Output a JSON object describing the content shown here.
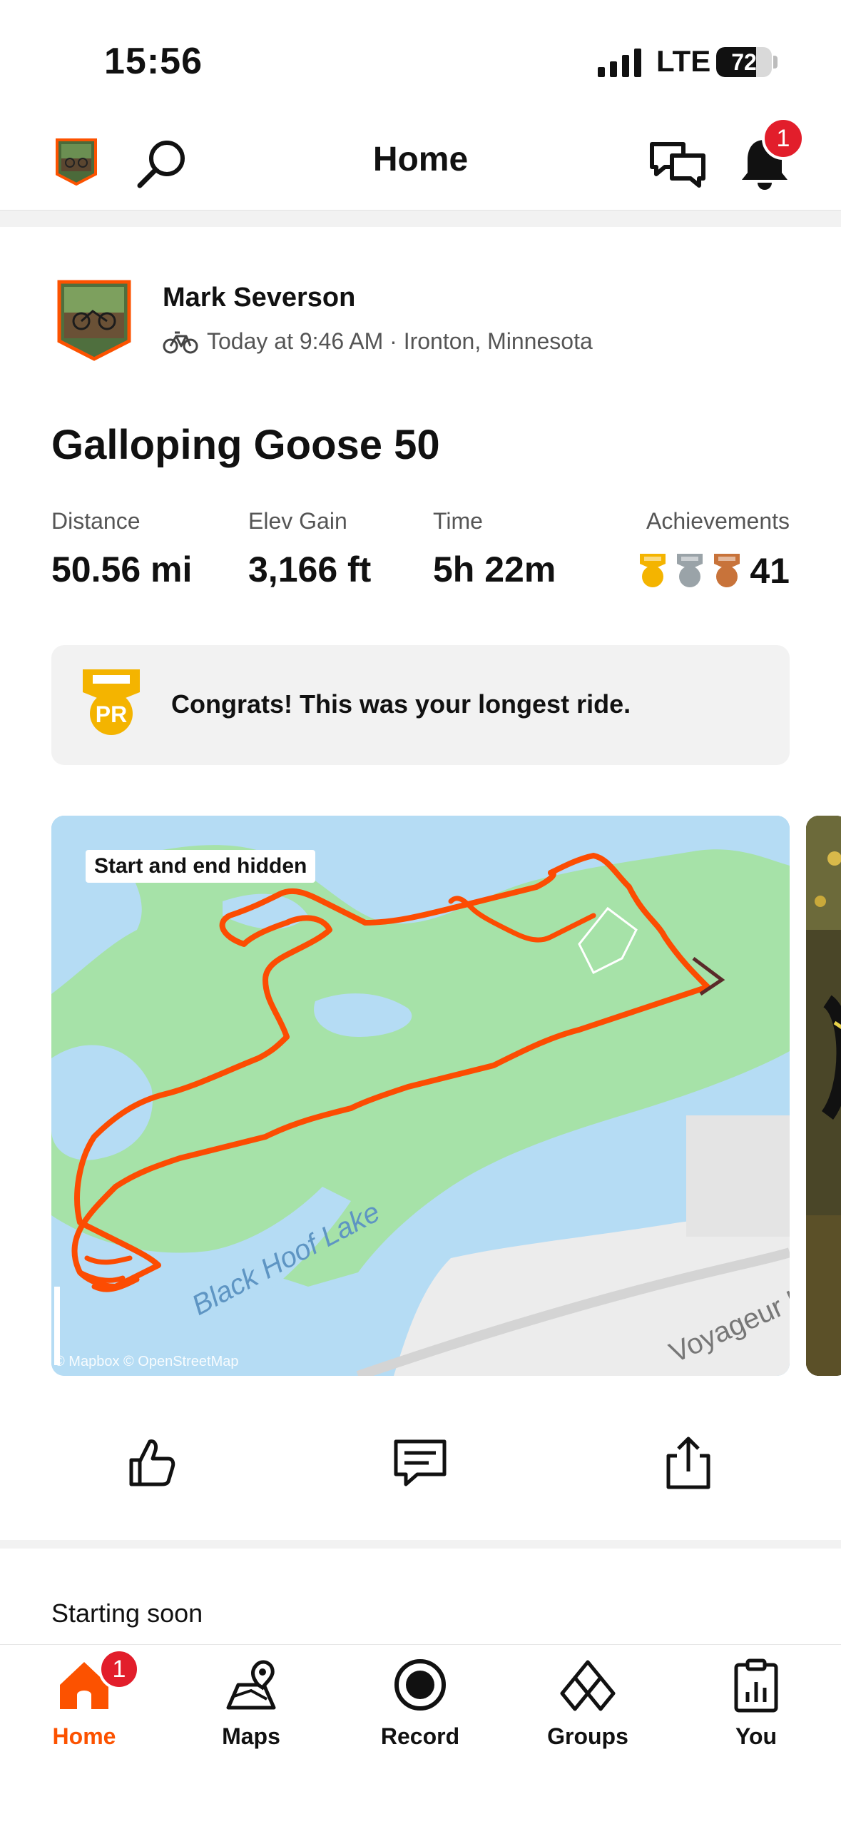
{
  "status_bar": {
    "time": "15:56",
    "network": "LTE",
    "battery_level": "72",
    "battery_fraction": 0.72
  },
  "header": {
    "title": "Home",
    "notification_count": "1"
  },
  "activity": {
    "athlete_name": "Mark Severson",
    "meta": "Today at 9:46 AM · Ironton, Minnesota",
    "title": "Galloping Goose 50",
    "stats": [
      {
        "label": "Distance",
        "value": "50.56 mi"
      },
      {
        "label": "Elev Gain",
        "value": "3,166 ft"
      },
      {
        "label": "Time",
        "value": "5h 22m"
      }
    ],
    "achievements": {
      "label": "Achievements",
      "count": "41",
      "medals": [
        "gold-medal-icon",
        "silver-medal-icon",
        "bronze-medal-icon"
      ]
    },
    "pr_badge": "PR",
    "pr_message": "Congrats! This was your longest ride.",
    "map": {
      "privacy_label": "Start and end hidden",
      "lake_label": "Black Hoof Lake",
      "road_label": "Voyageur H",
      "attribution": "© Mapbox © OpenStreetMap"
    }
  },
  "actions": [
    "kudos-icon",
    "comment-icon",
    "share-icon"
  ],
  "section": {
    "starting_soon": "Starting soon"
  },
  "tabs": [
    {
      "label": "Home",
      "active": true,
      "badge": "1"
    },
    {
      "label": "Maps"
    },
    {
      "label": "Record"
    },
    {
      "label": "Groups"
    },
    {
      "label": "You"
    }
  ],
  "colors": {
    "accent": "#fc5200",
    "badge": "#e21e2b",
    "water": "#b5dcf4",
    "park": "#a6e2a8",
    "land": "#ececec",
    "gold": "#f4b400",
    "silver": "#9aa3a8",
    "bronze": "#c8733a"
  }
}
